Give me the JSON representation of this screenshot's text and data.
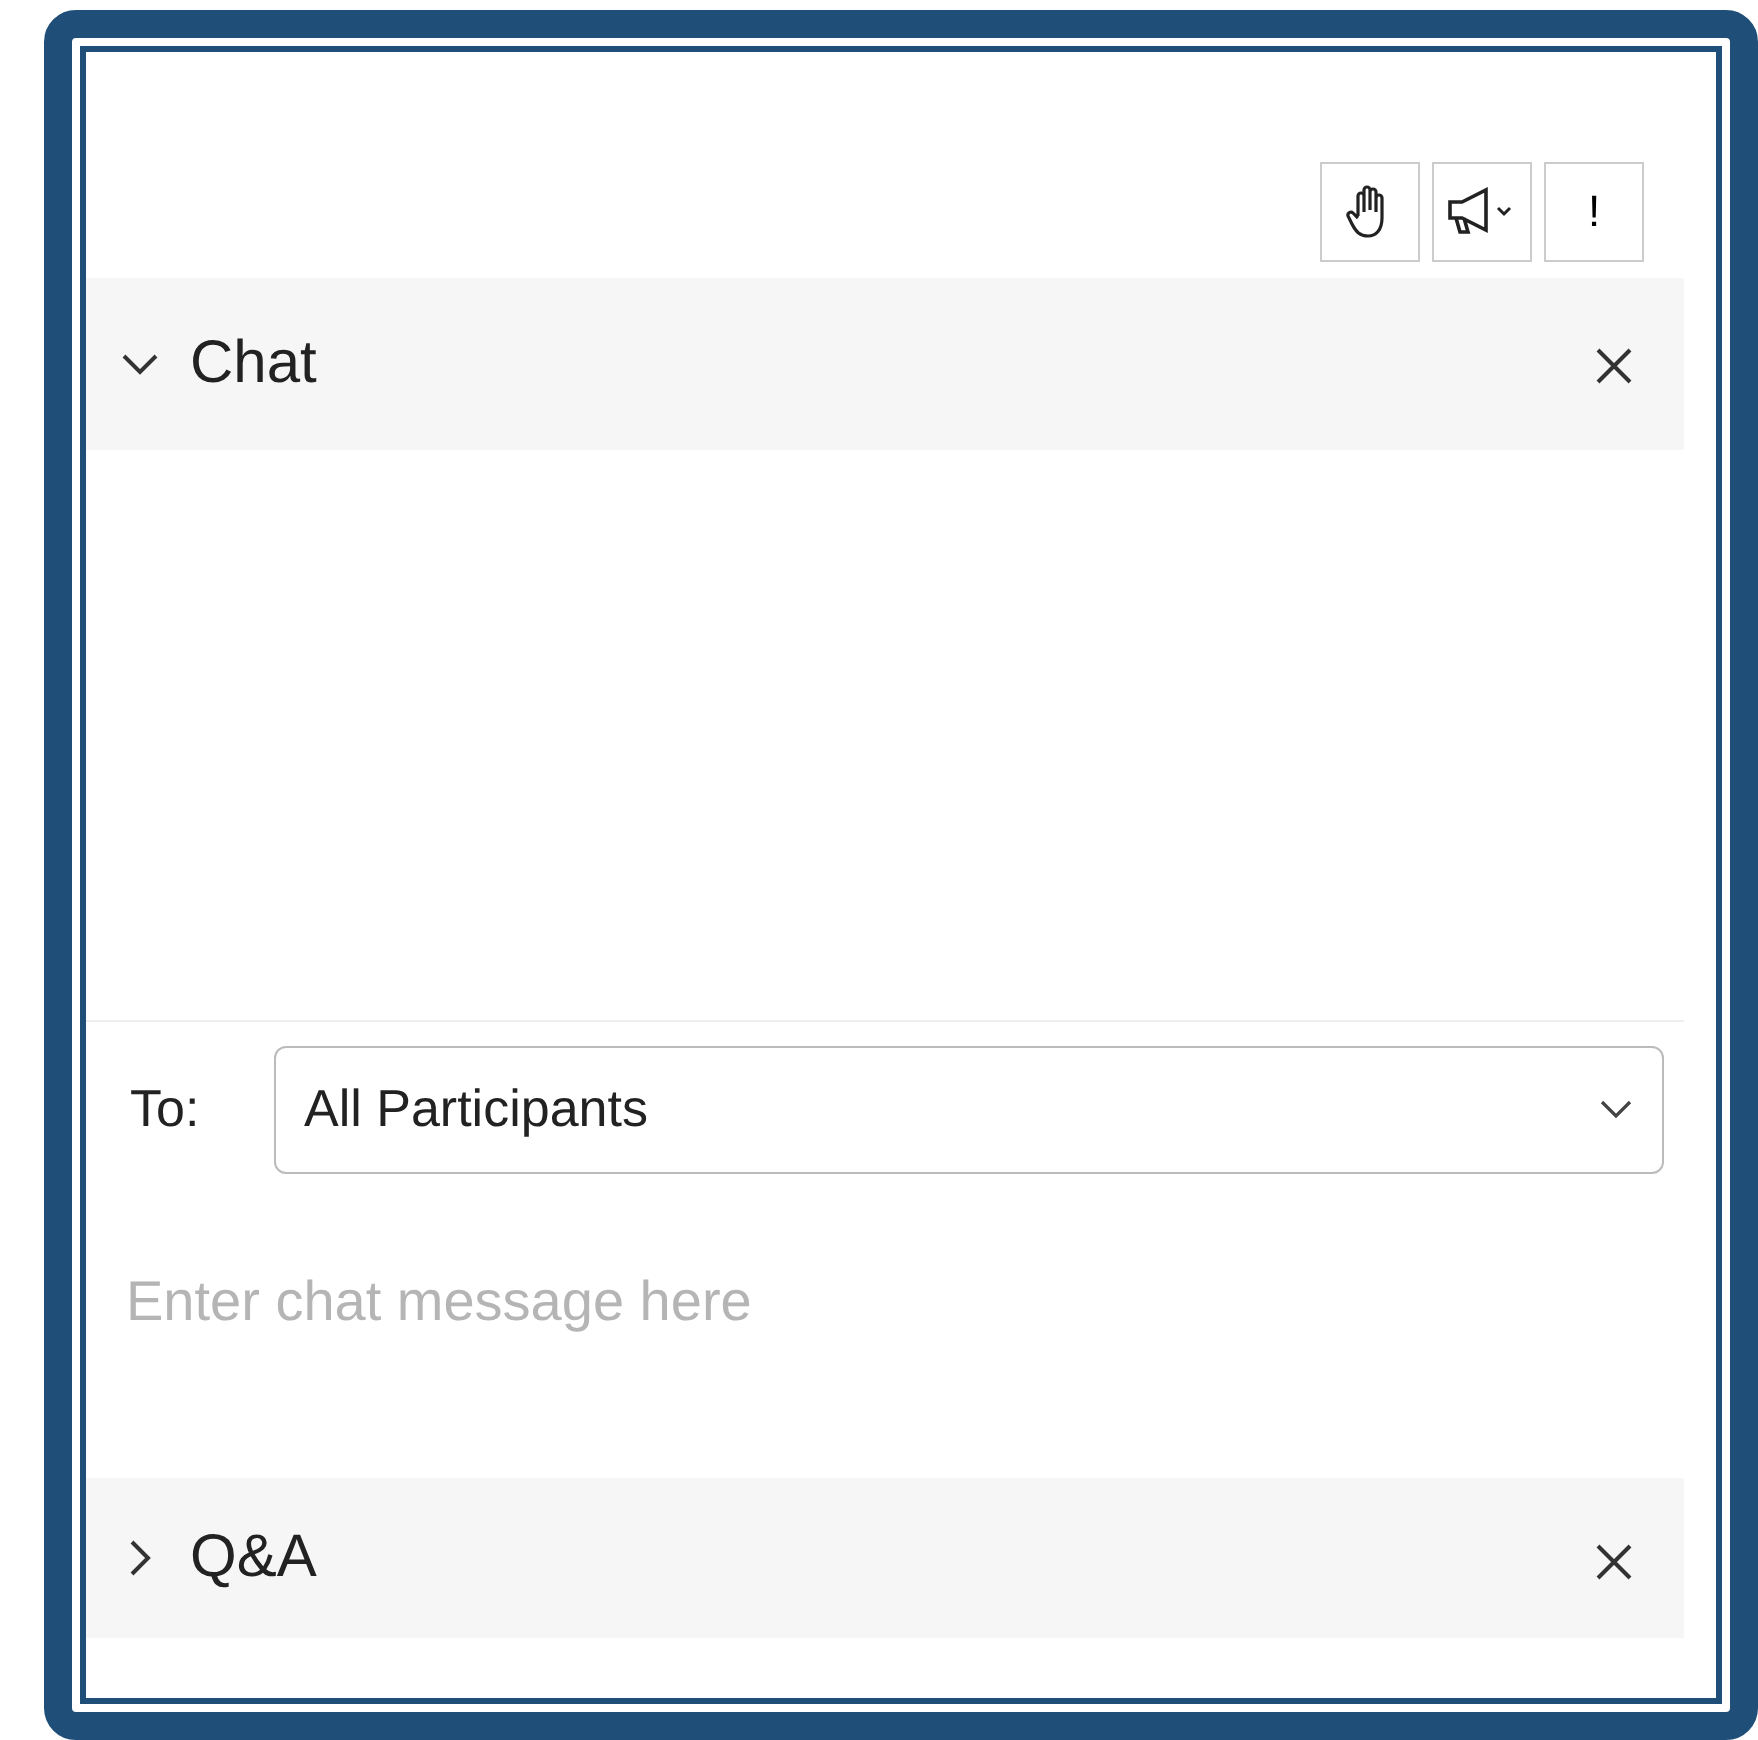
{
  "toolbar": {
    "alert_button": "!"
  },
  "chat": {
    "title": "Chat",
    "expanded": true,
    "to_label": "To:",
    "recipient": "All Participants",
    "message": {
      "placeholder": "Enter chat message here"
    }
  },
  "qa": {
    "title": "Q&A",
    "expanded": false
  }
}
